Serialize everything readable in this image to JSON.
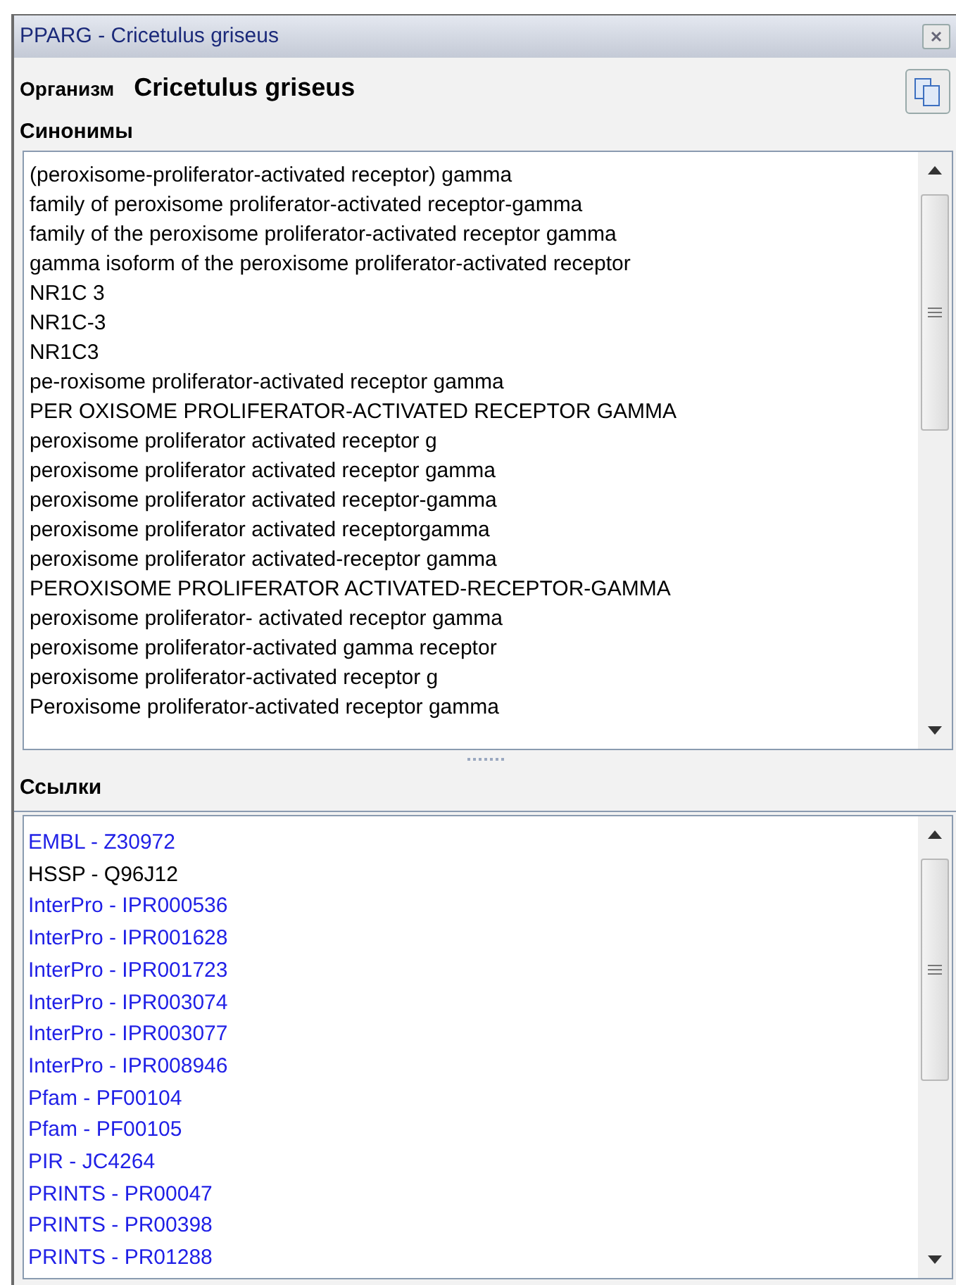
{
  "window": {
    "title": "PPARG - Cricetulus griseus"
  },
  "organism": {
    "label": "Организм",
    "value": "Cricetulus griseus"
  },
  "synonyms": {
    "label": "Синонимы",
    "items": [
      "(peroxisome-proliferator-activated receptor) gamma",
      "family of peroxisome proliferator-activated receptor-gamma",
      "family of the peroxisome proliferator-activated receptor gamma",
      "gamma isoform of the peroxisome proliferator-activated receptor",
      "NR1C 3",
      "NR1C-3",
      "NR1C3",
      "pe-roxisome proliferator-activated receptor gamma",
      "PER OXISOME PROLIFERATOR-ACTIVATED RECEPTOR GAMMA",
      "peroxisome proliferator activated receptor g",
      "peroxisome proliferator activated receptor gamma",
      "peroxisome proliferator activated receptor-gamma",
      "peroxisome proliferator activated receptorgamma",
      "peroxisome proliferator activated-receptor gamma",
      "PEROXISOME PROLIFERATOR ACTIVATED-RECEPTOR-GAMMA",
      "peroxisome proliferator- activated receptor gamma",
      "peroxisome proliferator-activated gamma receptor",
      "peroxisome proliferator-activated receptor g",
      "Peroxisome proliferator-activated receptor gamma"
    ]
  },
  "links": {
    "label": "Ссылки",
    "items": [
      {
        "text": "EMBL - Z30972",
        "kind": "link"
      },
      {
        "text": "HSSP - Q96J12",
        "kind": "plain"
      },
      {
        "text": "InterPro - IPR000536",
        "kind": "link"
      },
      {
        "text": "InterPro - IPR001628",
        "kind": "link"
      },
      {
        "text": "InterPro - IPR001723",
        "kind": "link"
      },
      {
        "text": "InterPro - IPR003074",
        "kind": "link"
      },
      {
        "text": "InterPro - IPR003077",
        "kind": "link"
      },
      {
        "text": "InterPro - IPR008946",
        "kind": "link"
      },
      {
        "text": "Pfam - PF00104",
        "kind": "link"
      },
      {
        "text": "Pfam - PF00105",
        "kind": "link"
      },
      {
        "text": "PIR - JC4264",
        "kind": "link"
      },
      {
        "text": "PRINTS - PR00047",
        "kind": "link"
      },
      {
        "text": "PRINTS - PR00398",
        "kind": "link"
      },
      {
        "text": "PRINTS - PR01288",
        "kind": "link"
      }
    ]
  }
}
